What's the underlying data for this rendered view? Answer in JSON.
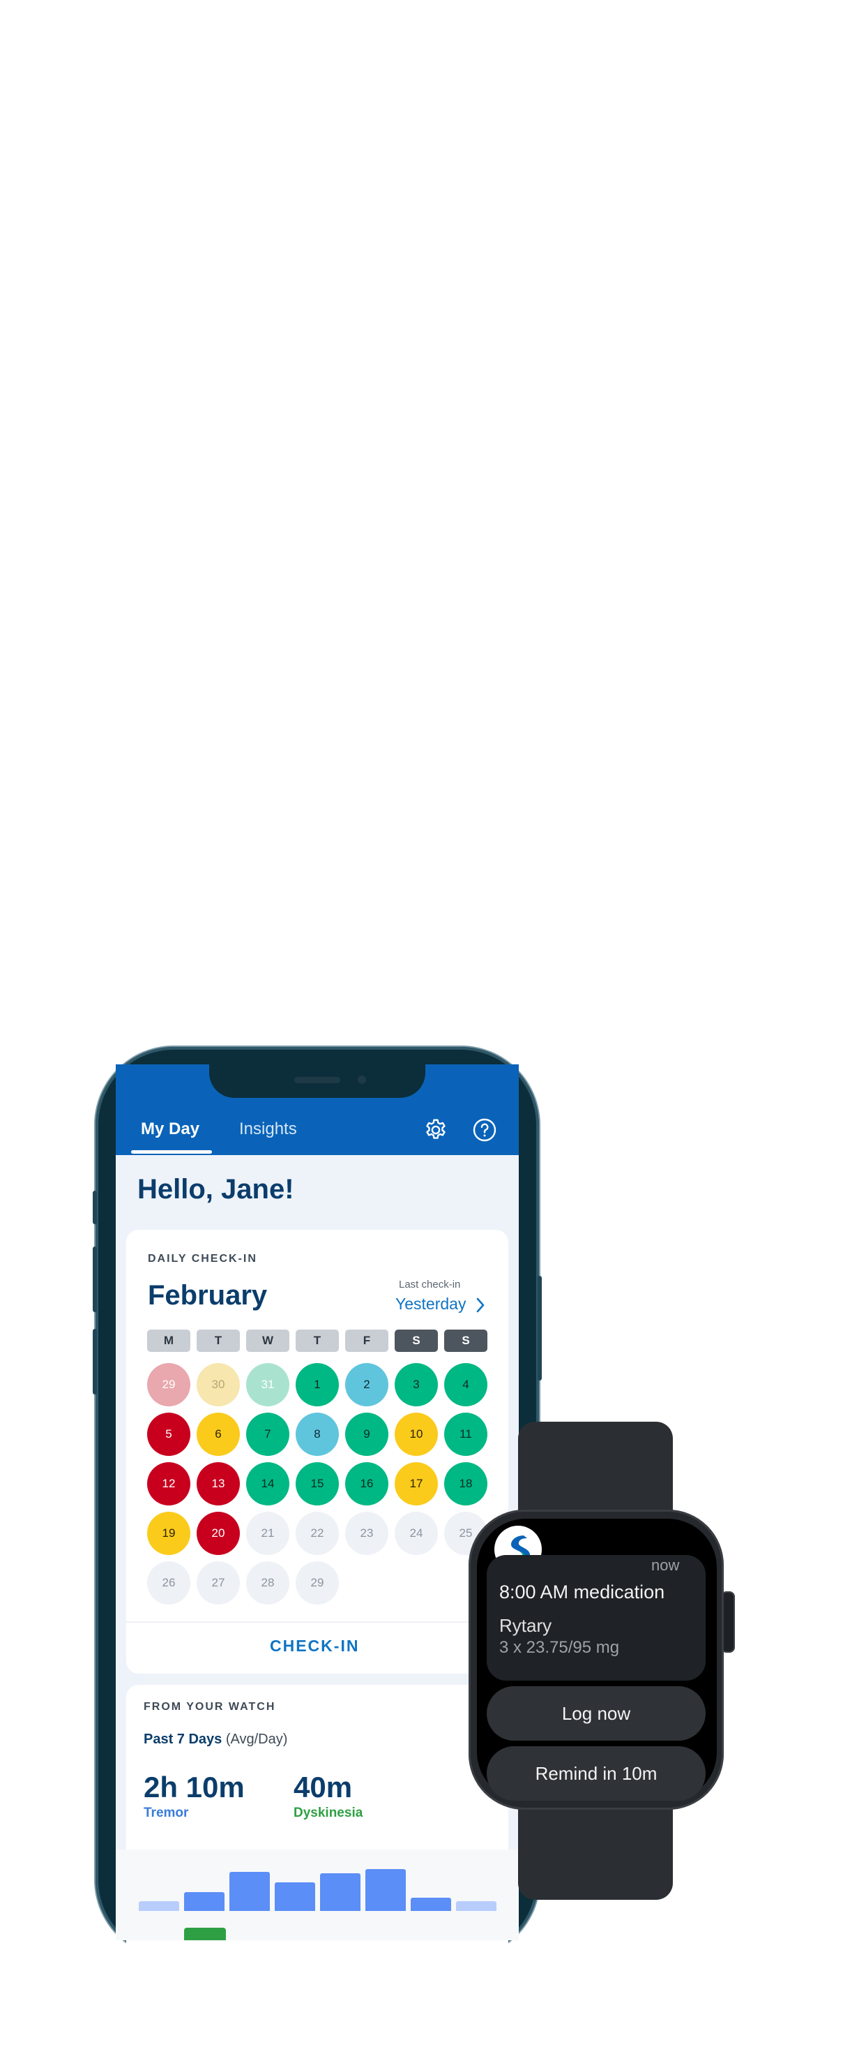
{
  "app": {
    "tabs": [
      {
        "label": "My Day"
      },
      {
        "label": "Insights"
      }
    ],
    "greeting": "Hello, Jane!"
  },
  "checkin": {
    "section_label": "DAILY CHECK-IN",
    "month": "February",
    "last_checkin_label": "Last check-in",
    "last_checkin_value": "Yesterday",
    "weekdays": [
      "M",
      "T",
      "W",
      "T",
      "F",
      "S",
      "S"
    ],
    "days": [
      {
        "n": "29",
        "status": "pink"
      },
      {
        "n": "30",
        "status": "ltyel"
      },
      {
        "n": "31",
        "status": "ltgrn"
      },
      {
        "n": "1",
        "status": "green"
      },
      {
        "n": "2",
        "status": "cyan"
      },
      {
        "n": "3",
        "status": "green"
      },
      {
        "n": "4",
        "status": "green"
      },
      {
        "n": "5",
        "status": "red"
      },
      {
        "n": "6",
        "status": "yellow"
      },
      {
        "n": "7",
        "status": "green"
      },
      {
        "n": "8",
        "status": "cyan"
      },
      {
        "n": "9",
        "status": "green"
      },
      {
        "n": "10",
        "status": "yellow"
      },
      {
        "n": "11",
        "status": "green"
      },
      {
        "n": "12",
        "status": "red"
      },
      {
        "n": "13",
        "status": "red"
      },
      {
        "n": "14",
        "status": "green"
      },
      {
        "n": "15",
        "status": "green"
      },
      {
        "n": "16",
        "status": "green"
      },
      {
        "n": "17",
        "status": "yellow"
      },
      {
        "n": "18",
        "status": "green"
      },
      {
        "n": "19",
        "status": "yellow"
      },
      {
        "n": "20",
        "status": "red"
      },
      {
        "n": "21",
        "status": "empty"
      },
      {
        "n": "22",
        "status": "empty"
      },
      {
        "n": "23",
        "status": "empty"
      },
      {
        "n": "24",
        "status": "empty"
      },
      {
        "n": "25",
        "status": "empty"
      },
      {
        "n": "26",
        "status": "empty"
      },
      {
        "n": "27",
        "status": "empty"
      },
      {
        "n": "28",
        "status": "empty"
      },
      {
        "n": "29",
        "status": "empty"
      }
    ],
    "button": "CHECK-IN"
  },
  "watch_card": {
    "section_label": "FROM YOUR WATCH",
    "period": "Past 7 Days",
    "period_note": "(Avg/Day)",
    "tremor_value": "2h 10m",
    "tremor_label": "Tremor",
    "dysk_value": "40m",
    "dysk_label": "Dyskinesia",
    "chart_levels": [
      0.23,
      0.45,
      0.93,
      0.68,
      0.9,
      1.0,
      0.32,
      0.23
    ]
  },
  "watch": {
    "time": "now",
    "title": "8:00 AM medication",
    "drug": "Rytary",
    "dose": "3 x 23.75/95 mg",
    "btn_log": "Log now",
    "btn_remind": "Remind in 10m"
  },
  "colors": {
    "brand_blue": "#0a63b8",
    "dark_blue": "#0b3d6b",
    "green": "#00b884",
    "yellow": "#fbcb1c",
    "red": "#c8001e",
    "cyan": "#5fc5dc"
  },
  "icons": [
    "gear-icon",
    "help-icon",
    "chevron-right-icon",
    "app-logo-icon"
  ]
}
